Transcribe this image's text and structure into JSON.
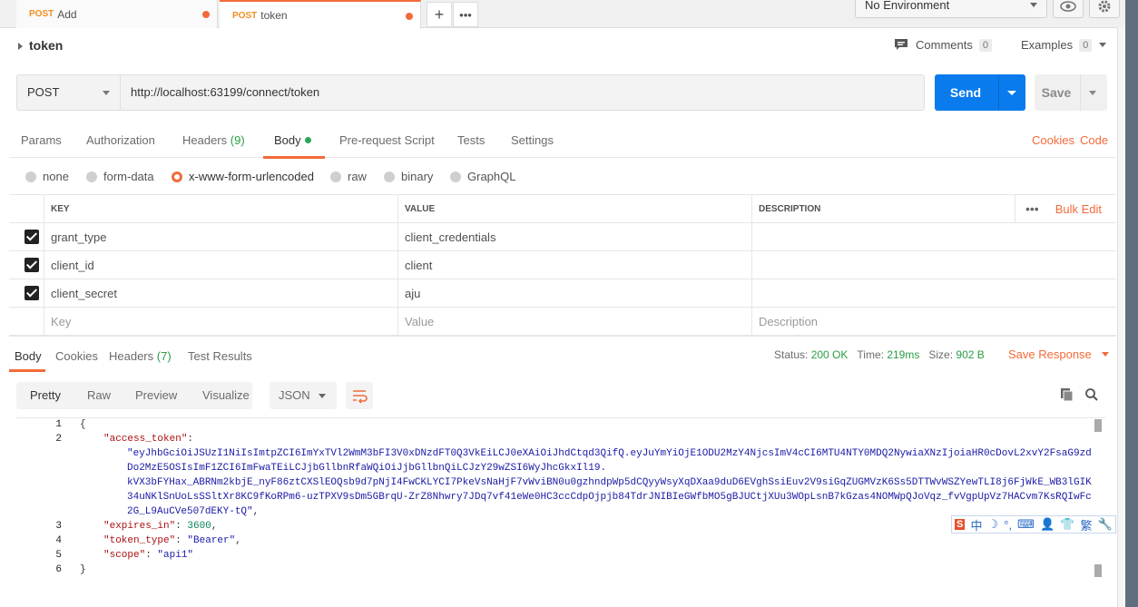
{
  "tabs": [
    {
      "method": "POST",
      "name": "Add"
    },
    {
      "method": "POST",
      "name": "token"
    }
  ],
  "env": {
    "selected": "No Environment"
  },
  "request": {
    "title": "token",
    "comments_label": "Comments",
    "comments_count": "0",
    "examples_label": "Examples",
    "examples_count": "0",
    "method": "POST",
    "url": "http://localhost:63199/connect/token",
    "send_label": "Send",
    "save_label": "Save"
  },
  "req_tabs": {
    "params": "Params",
    "authorization": "Authorization",
    "headers": "Headers",
    "headers_count": "(9)",
    "body": "Body",
    "prerequest": "Pre-request Script",
    "tests": "Tests",
    "settings": "Settings",
    "cookies": "Cookies",
    "code": "Code"
  },
  "body_modes": {
    "none": "none",
    "form_data": "form-data",
    "urlencoded": "x-www-form-urlencoded",
    "raw": "raw",
    "binary": "binary",
    "graphql": "GraphQL",
    "selected": "x-www-form-urlencoded"
  },
  "params_table": {
    "headers": {
      "key": "KEY",
      "value": "VALUE",
      "description": "DESCRIPTION",
      "bulk_edit": "Bulk Edit"
    },
    "rows": [
      {
        "key": "grant_type",
        "value": "client_credentials",
        "checked": true
      },
      {
        "key": "client_id",
        "value": "client",
        "checked": true
      },
      {
        "key": "client_secret",
        "value": "aju",
        "checked": true
      }
    ],
    "placeholder": {
      "key": "Key",
      "value": "Value",
      "description": "Description"
    }
  },
  "response": {
    "tabs": {
      "body": "Body",
      "cookies": "Cookies",
      "headers": "Headers",
      "headers_count": "(7)",
      "test_results": "Test Results"
    },
    "status_label": "Status:",
    "status": "200 OK",
    "time_label": "Time:",
    "time": "219ms",
    "size_label": "Size:",
    "size": "902 B",
    "save_response": "Save Response",
    "view_modes": {
      "pretty": "Pretty",
      "raw": "Raw",
      "preview": "Preview",
      "visualize": "Visualize"
    },
    "format": "JSON",
    "code_lines": [
      {
        "n": "1",
        "text": "{"
      },
      {
        "n": "2",
        "key": "\"access_token\"",
        "text": ":"
      },
      {
        "n": "",
        "str": "\"eyJhbGciOiJSUzI1NiIsImtpZCI6ImYxTVl2WmM3bFI3V0xDNzdFT0Q3VkEiLCJ0eXAiOiJhdCtqd3QifQ.eyJuYmYiOjE1ODU2MzY4NjcsImV4cCI6MTU4NTY0MDQ2NywiaXNzIjoiaHR0cDovL2xvY2FsaG9zd"
      },
      {
        "n": "",
        "str": "Do2MzE5OSIsImF1ZCI6ImFwaTEiLCJjbGllbnRfaWQiOiJjbGllbnQiLCJzY29wZSI6WyJhcGkxIl19."
      },
      {
        "n": "",
        "str": "kVX3bFYHax_ABRNm2kbjE_nyF86ztCXSlEOQsb9d7pNjI4FwCKLYCI7PkeVsNaHjF7vWviBN0u0gzhndpWp5dCQyyWsyXqDXaa9duD6EVghSsiEuv2V9siGqZUGMVzK6Ss5DTTWvWSZYewTLI8j6FjWkE_WB3lGIK"
      },
      {
        "n": "",
        "str": "34uNKlSnUoLsSSltXr8KC9fKoRPm6-uzTPXV9sDm5GBrqU-ZrZ8Nhwry7JDq7vf41eWe0HC3ccCdpOjpjb84TdrJNIBIeGWfbMO5gBJUCtjXUu3WOpLsnB7kGzas4NOMWpQJoVqz_fvVgpUpVz7HACvm7KsRQIwFc"
      },
      {
        "n": "",
        "str": "2G_L9AuCVe507dEKY-tQ\"",
        "text": ","
      },
      {
        "n": "3",
        "key": "\"expires_in\"",
        "text": ": ",
        "num": "3600",
        "tail": ","
      },
      {
        "n": "4",
        "key": "\"token_type\"",
        "text": ": ",
        "str": "\"Bearer\"",
        "tail": ","
      },
      {
        "n": "5",
        "key": "\"scope\"",
        "text": ": ",
        "str": "\"api1\""
      },
      {
        "n": "6",
        "text": "}"
      }
    ]
  },
  "ime": {
    "chars": [
      "S",
      "中",
      "☽",
      "°,",
      "⌨",
      "👤",
      "👕",
      "繁",
      "🔧"
    ]
  }
}
